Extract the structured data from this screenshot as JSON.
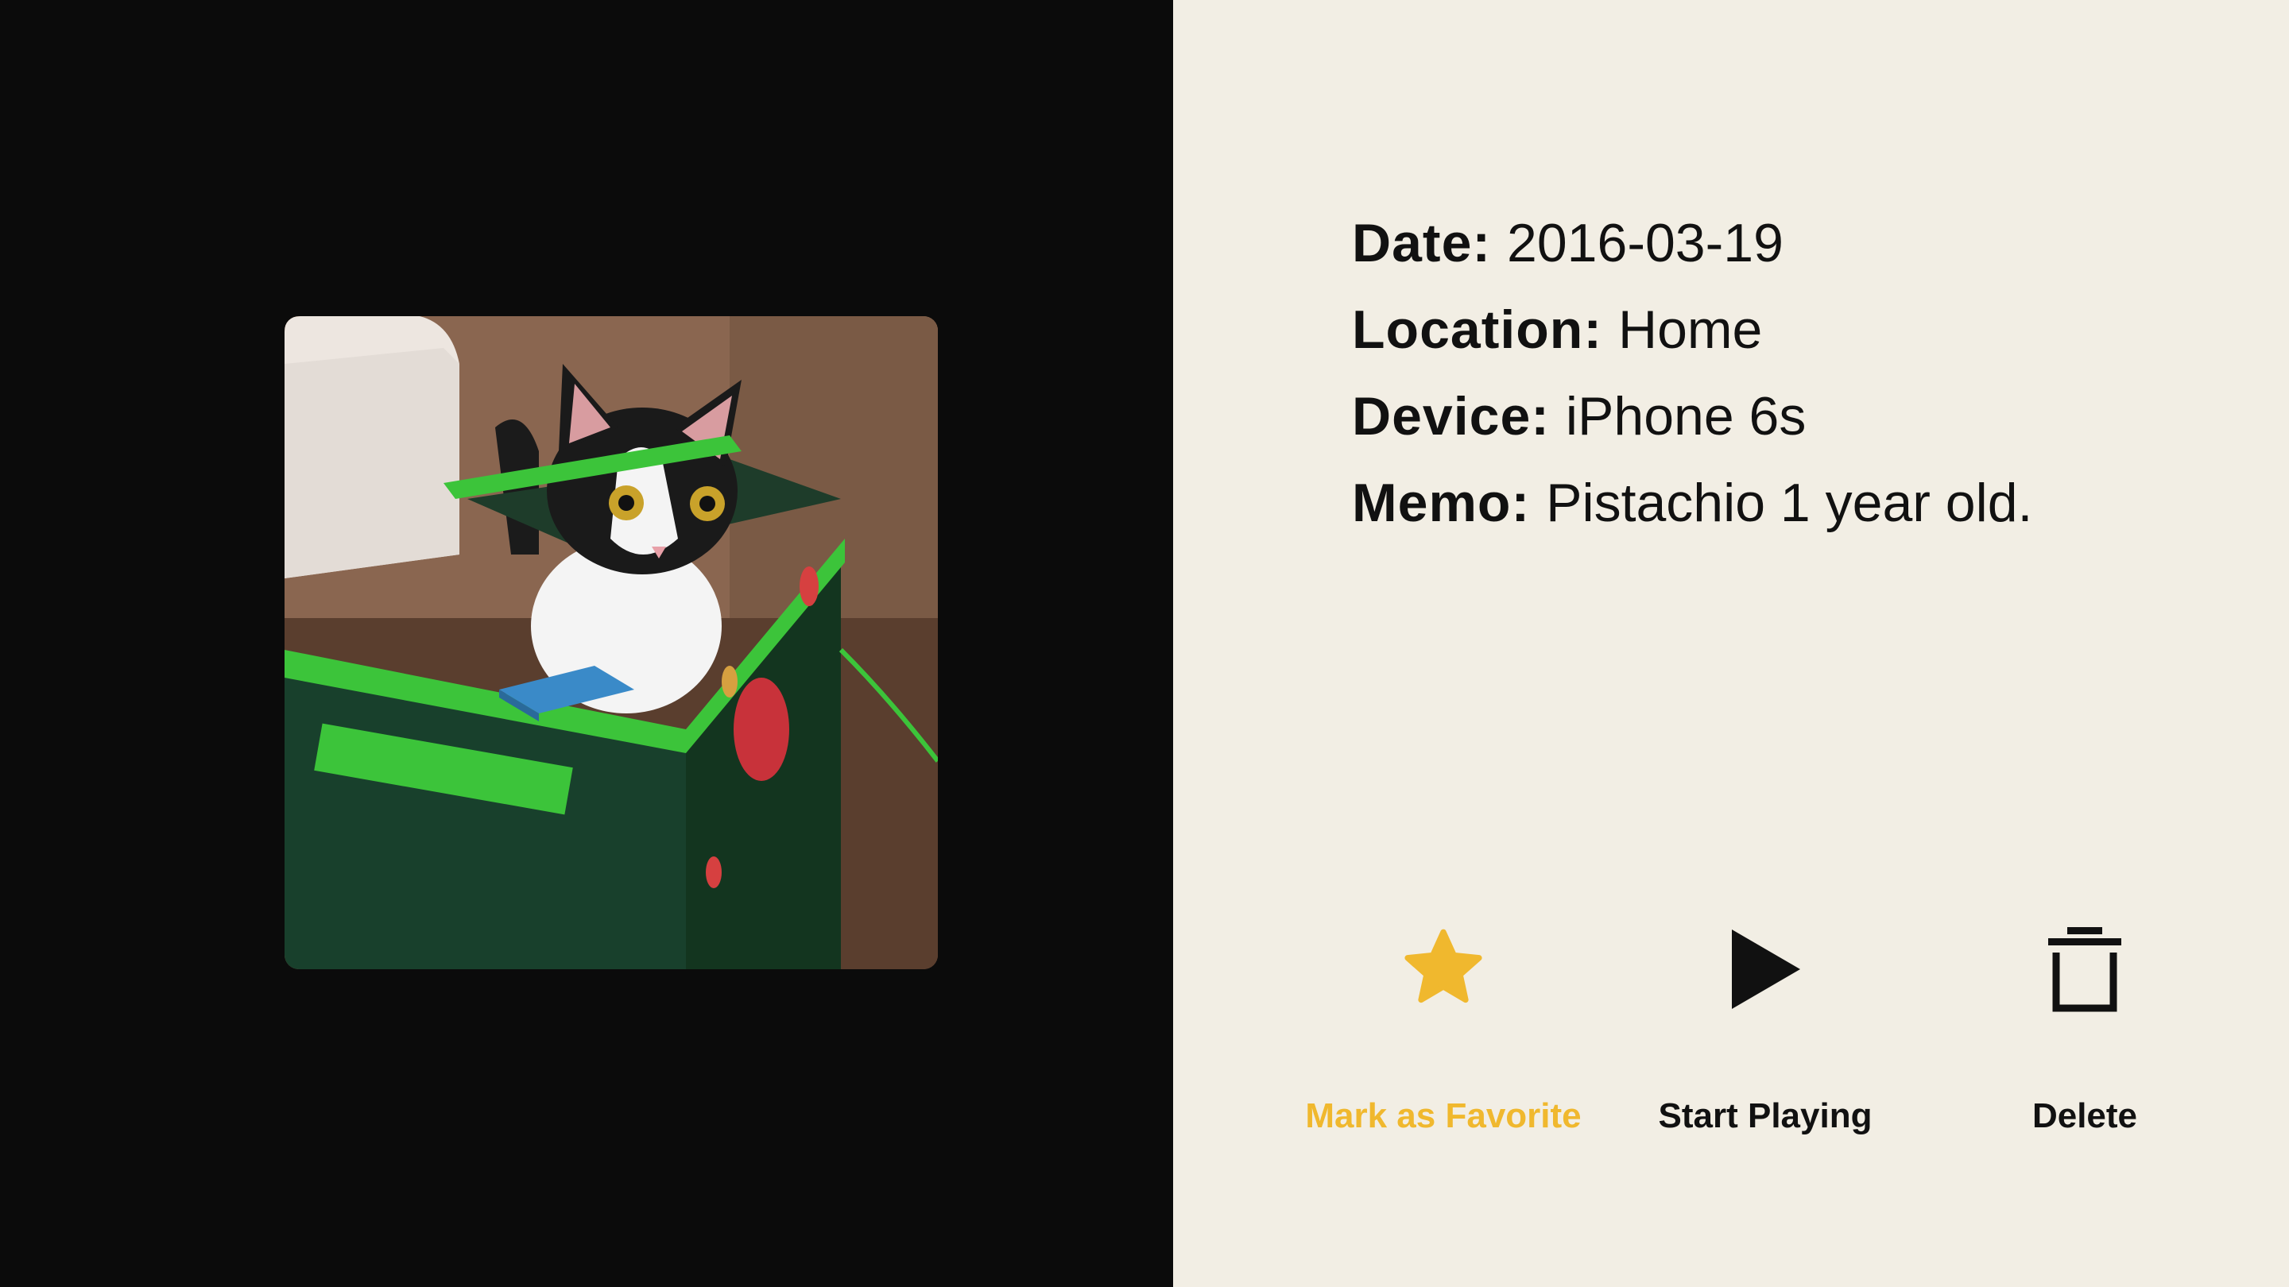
{
  "details": {
    "date_key": "Date:",
    "date_value": "2016-03-19",
    "location_key": "Location:",
    "location_value": "Home",
    "device_key": "Device:",
    "device_value": "iPhone 6s",
    "memo_key": "Memo:",
    "memo_value": "Pistachio 1 year old."
  },
  "actions": {
    "favorite": {
      "label": "Mark as Favorite",
      "icon": "star-icon",
      "color": "#f0b82e"
    },
    "play": {
      "label": "Start Playing",
      "icon": "play-icon",
      "color": "#111111"
    },
    "delete": {
      "label": "Delete",
      "icon": "trash-icon",
      "color": "#111111"
    }
  },
  "photo": {
    "subject": "cat-in-green-box-photo"
  },
  "colors": {
    "left_background": "#0b0b0b",
    "right_background": "#f2eee4",
    "accent": "#f0b82e"
  }
}
